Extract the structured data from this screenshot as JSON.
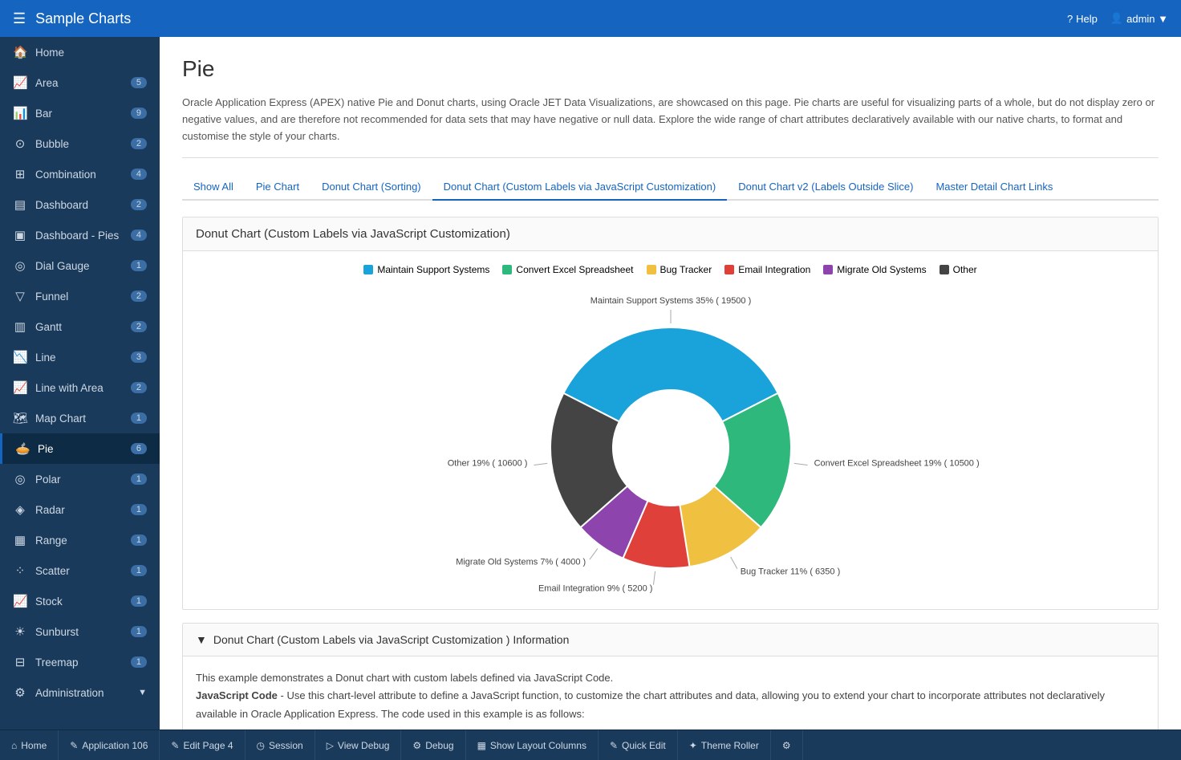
{
  "header": {
    "title": "Sample Charts",
    "hamburger_icon": "☰",
    "help_label": "Help",
    "admin_label": "admin ▼"
  },
  "sidebar": {
    "items": [
      {
        "label": "Home",
        "icon": "⌂",
        "badge": null,
        "active": false
      },
      {
        "label": "Area",
        "icon": "▨",
        "badge": "5",
        "active": false
      },
      {
        "label": "Bar",
        "icon": "▦",
        "badge": "9",
        "active": false
      },
      {
        "label": "Bubble",
        "icon": "⊙",
        "badge": "2",
        "active": false
      },
      {
        "label": "Combination",
        "icon": "⊞",
        "badge": "4",
        "active": false
      },
      {
        "label": "Dashboard",
        "icon": "▤",
        "badge": "2",
        "active": false
      },
      {
        "label": "Dashboard - Pies",
        "icon": "▣",
        "badge": "4",
        "active": false
      },
      {
        "label": "Dial Gauge",
        "icon": "◎",
        "badge": "1",
        "active": false
      },
      {
        "label": "Funnel",
        "icon": "▽",
        "badge": "2",
        "active": false
      },
      {
        "label": "Gantt",
        "icon": "▥",
        "badge": "2",
        "active": false
      },
      {
        "label": "Line",
        "icon": "∿",
        "badge": "3",
        "active": false
      },
      {
        "label": "Line with Area",
        "icon": "∿",
        "badge": "2",
        "active": false
      },
      {
        "label": "Map Chart",
        "icon": "⊕",
        "badge": "1",
        "active": false
      },
      {
        "label": "Pie",
        "icon": "◔",
        "badge": "6",
        "active": true
      },
      {
        "label": "Polar",
        "icon": "◎",
        "badge": "1",
        "active": false
      },
      {
        "label": "Radar",
        "icon": "◈",
        "badge": "1",
        "active": false
      },
      {
        "label": "Range",
        "icon": "▦",
        "badge": "1",
        "active": false
      },
      {
        "label": "Scatter",
        "icon": "⁘",
        "badge": "1",
        "active": false
      },
      {
        "label": "Stock",
        "icon": "▦",
        "badge": "1",
        "active": false
      },
      {
        "label": "Sunburst",
        "icon": "✿",
        "badge": "1",
        "active": false
      },
      {
        "label": "Treemap",
        "icon": "⊟",
        "badge": "1",
        "active": false
      },
      {
        "label": "Administration",
        "icon": "⚙",
        "badge": null,
        "active": false,
        "has_arrow": true
      }
    ]
  },
  "page": {
    "title": "Pie",
    "description": "Oracle Application Express (APEX) native Pie and Donut charts, using Oracle JET Data Visualizations, are showcased on this page. Pie charts are useful for visualizing parts of a whole, but do not display zero or negative values, and are therefore not recommended for data sets that may have negative or null data. Explore the wide range of chart attributes declaratively available with our native charts, to format and customise the style of your charts."
  },
  "tabs": [
    {
      "label": "Show All",
      "active": false
    },
    {
      "label": "Pie Chart",
      "active": false
    },
    {
      "label": "Donut Chart (Sorting)",
      "active": false
    },
    {
      "label": "Donut Chart (Custom Labels via JavaScript Customization)",
      "active": true
    },
    {
      "label": "Donut Chart v2 (Labels Outside Slice)",
      "active": false
    },
    {
      "label": "Master Detail Chart Links",
      "active": false
    }
  ],
  "chart_section": {
    "title": "Donut Chart (Custom Labels via JavaScript Customization)",
    "legend": [
      {
        "label": "Maintain Support Systems",
        "color": "#1aa3db"
      },
      {
        "label": "Convert Excel Spreadsheet",
        "color": "#2eb87c"
      },
      {
        "label": "Bug Tracker",
        "color": "#f0c040"
      },
      {
        "label": "Email Integration",
        "color": "#e0403a"
      },
      {
        "label": "Migrate Old Systems",
        "color": "#8e44ad"
      },
      {
        "label": "Other",
        "color": "#444444"
      }
    ],
    "slices": [
      {
        "label": "Maintain Support Systems 35% ( 19500 )",
        "value": 19500,
        "percent": 35,
        "color": "#1aa3db",
        "startAngle": -62,
        "sweepAngle": 126
      },
      {
        "label": "Convert Excel Spreadsheet 19% ( 10500 )",
        "value": 10500,
        "percent": 19,
        "color": "#2eb87c",
        "startAngle": 64,
        "sweepAngle": 68
      },
      {
        "label": "Bug Tracker 11% ( 6350 )",
        "value": 6350,
        "percent": 11,
        "color": "#f0c040",
        "startAngle": 132,
        "sweepAngle": 40
      },
      {
        "label": "Email Integration 9% ( 5200 )",
        "value": 5200,
        "percent": 9,
        "color": "#e0403a",
        "startAngle": 172,
        "sweepAngle": 32
      },
      {
        "label": "Migrate Old Systems 7% ( 4000 )",
        "value": 4000,
        "percent": 7,
        "color": "#8e44ad",
        "startAngle": 204,
        "sweepAngle": 25
      },
      {
        "label": "Other 19% ( 10600 )",
        "value": 10600,
        "percent": 19,
        "color": "#444444",
        "startAngle": 229,
        "sweepAngle": 69
      }
    ]
  },
  "info_section": {
    "title": "Donut Chart (Custom Labels via JavaScript Customization ) Information",
    "collapsed": false,
    "text_line1": "This example demonstrates a Donut chart with custom labels defined via JavaScript Code.",
    "text_line2_prefix": "JavaScript Code",
    "text_line2_body": " - Use this chart-level attribute to define a JavaScript function, to customize the chart attributes and data, allowing you to extend your chart to incorporate attributes not declaratively available in Oracle Application Express. The code used in this example is as follows:"
  },
  "bottom_bar": {
    "items": [
      {
        "label": "Home",
        "icon": "⌂"
      },
      {
        "label": "Application 106",
        "icon": "✎"
      },
      {
        "label": "Edit Page 4",
        "icon": "✎"
      },
      {
        "label": "Session",
        "icon": "◷"
      },
      {
        "label": "View Debug",
        "icon": "▷"
      },
      {
        "label": "Debug",
        "icon": "⚙"
      },
      {
        "label": "Show Layout Columns",
        "icon": "▦"
      },
      {
        "label": "Quick Edit",
        "icon": "✎"
      },
      {
        "label": "Theme Roller",
        "icon": "✦"
      },
      {
        "label": "⚙",
        "icon": ""
      }
    ]
  }
}
